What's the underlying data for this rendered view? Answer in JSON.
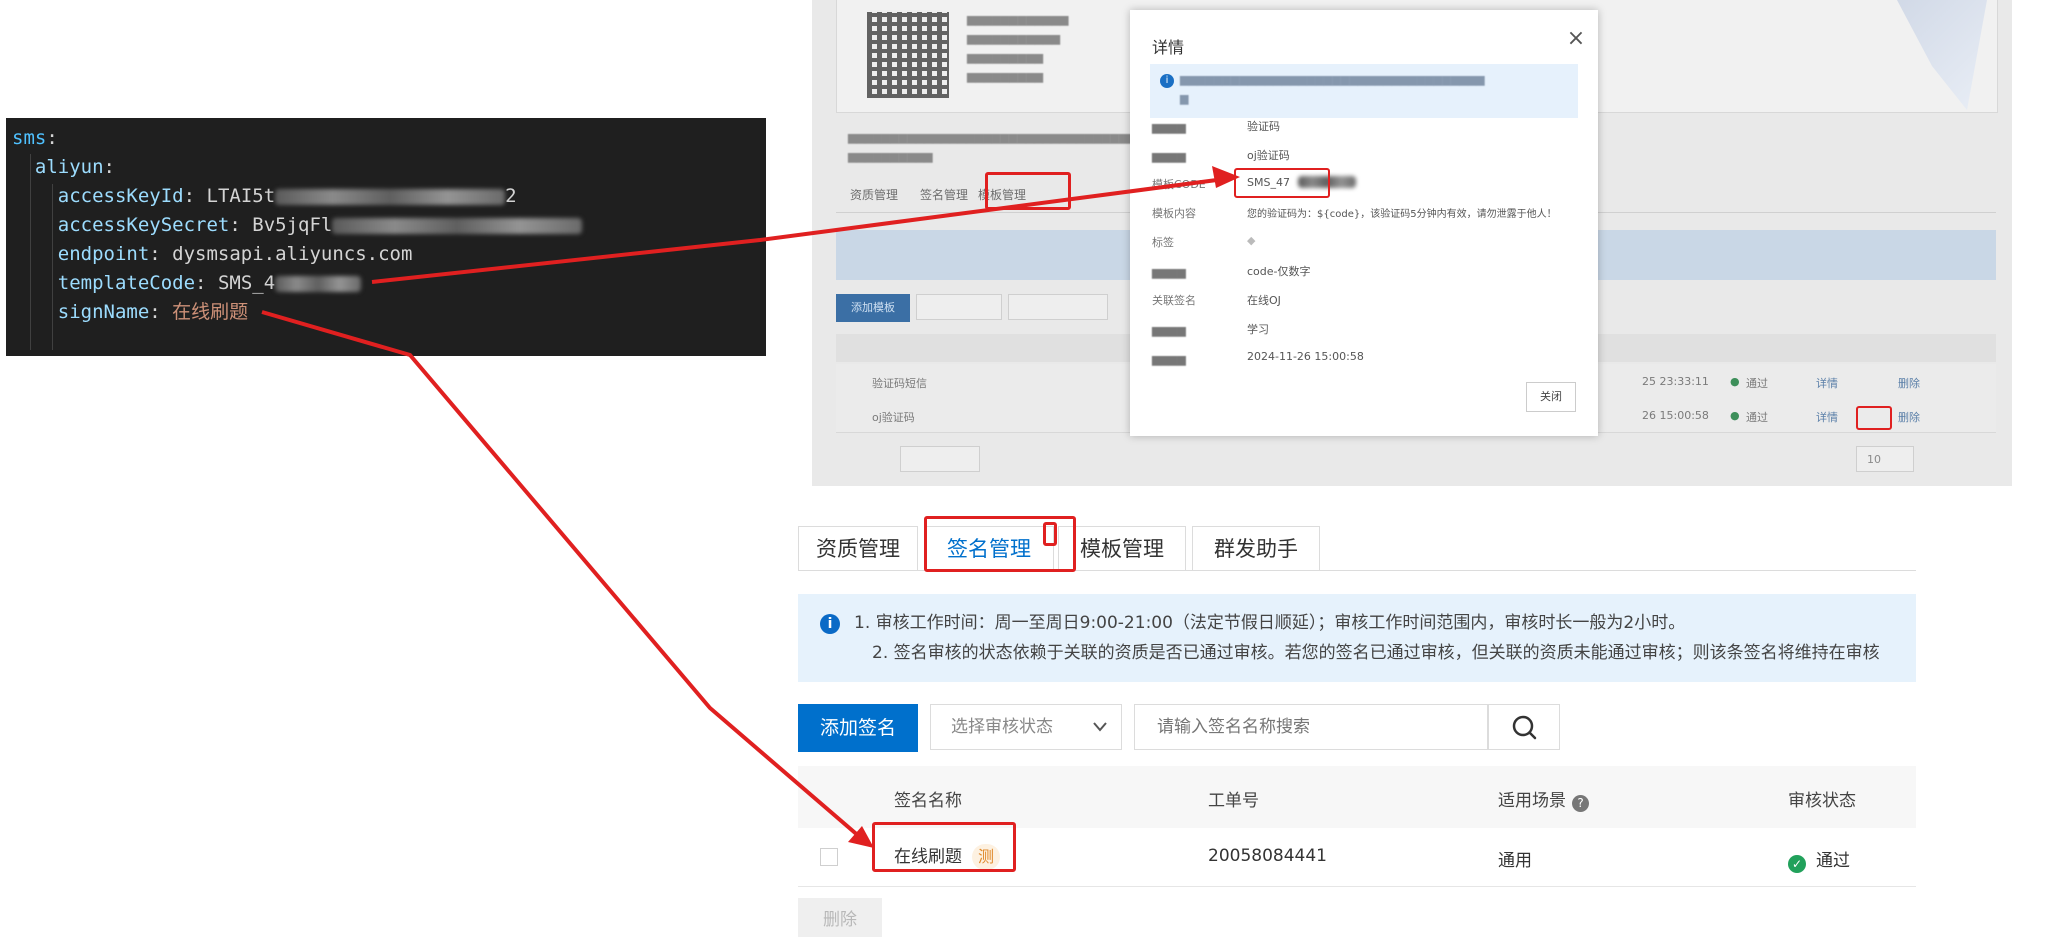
{
  "editor": {
    "lines": {
      "l0": {
        "key": "sms"
      },
      "l1": {
        "key": "aliyun"
      },
      "l2": {
        "key": "accessKeyId",
        "value": "LTAI5t",
        "value_tail": "2"
      },
      "l3": {
        "key": "accessKeySecret",
        "value": "Bv5jqFl"
      },
      "l4": {
        "key": "endpoint",
        "value": "dysmsapi.aliyuncs.com"
      },
      "l5": {
        "key": "templateCode",
        "value": "SMS_4"
      },
      "l6": {
        "key": "signName",
        "value": "在线刷题"
      }
    }
  },
  "detail_modal": {
    "title": "详情",
    "rows": [
      {
        "value": "验证码"
      },
      {
        "value": "oj验证码"
      },
      {
        "label": "模板CODE",
        "value": "SMS_47"
      },
      {
        "label": "模板内容",
        "value": "您的验证码为：${code}，该验证码5分钟内有效，请勿泄露于他人！"
      },
      {
        "label": "标签"
      },
      {
        "value": "code-仅数字"
      },
      {
        "label": "关联签名",
        "value": "在线OJ"
      },
      {
        "value": "学习"
      },
      {
        "value": "2024-11-26 15:00:58"
      }
    ],
    "close_button": "关闭"
  },
  "background_console": {
    "tabs": [
      "资质管理",
      "签名管理",
      "模板管理"
    ],
    "buttons": {
      "add": "添加模板"
    },
    "rows": [
      {
        "name": "验证码短信",
        "time": "25 23:33:11",
        "status": "通过",
        "actions": [
          "详情",
          "删除"
        ]
      },
      {
        "name": "oj验证码",
        "time": "26 15:00:58",
        "status": "通过",
        "actions": [
          "详情",
          "删除"
        ]
      }
    ],
    "pagination": {
      "page_size": "10"
    }
  },
  "signature_console": {
    "tabs": [
      "资质管理",
      "签名管理",
      "模板管理",
      "群发助手"
    ],
    "active_tab": "签名管理",
    "notice": {
      "line1": "1. 审核工作时间：周一至周日9:00-21:00（法定节假日顺延）；审核工作时间范围内，审核时长一般为2小时。",
      "line2": "2. 签名审核的状态依赖于关联的资质是否已通过审核。若您的签名已通过审核，但关联的资质未能通过审核；则该条签名将维持在审核"
    },
    "add_button": "添加签名",
    "status_select": {
      "placeholder": "选择审核状态"
    },
    "search": {
      "placeholder": "请输入签名名称搜索"
    },
    "columns": {
      "name": "签名名称",
      "order": "工单号",
      "scene": "适用场景",
      "status": "审核状态"
    },
    "rows": [
      {
        "name": "在线刷题",
        "tag": "测",
        "order": "20058084441",
        "scene": "通用",
        "status": "通过"
      }
    ],
    "delete_button": "删除"
  },
  "colors": {
    "annotation_red": "#e02020",
    "primary_blue": "#0070cc",
    "success_green": "#21a15b",
    "editor_bg": "#1f1f1f"
  }
}
